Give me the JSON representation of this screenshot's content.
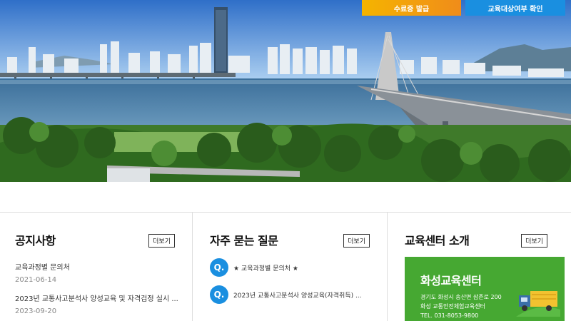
{
  "header": {
    "certificate_button": "수료증 발급",
    "eligibility_button": "교육대상여부 확인"
  },
  "notice": {
    "title": "공지사항",
    "more_label": "더보기",
    "items": [
      {
        "title": "교육과정별 문의처",
        "date": "2021-06-14"
      },
      {
        "title": "2023년 교통사고분석사 양성교육 및 자격검정 실시 ...",
        "date": "2023-09-20"
      }
    ]
  },
  "faq": {
    "title": "자주 묻는 질문",
    "more_label": "더보기",
    "q_marker": "Q.",
    "items": [
      {
        "text": "★ 교육과정별 문의처 ★"
      },
      {
        "text": "2023년 교통사고분석사 양성교육(자격취득) ..."
      }
    ]
  },
  "center": {
    "title": "교육센터 소개",
    "more_label": "더보기",
    "card": {
      "name": "화성교육센터",
      "address": "경기도 화성시 송산면 삼존로 200",
      "facility": "화성 교통안전체험교육센터",
      "tel": "TEL. 031-8053-9800"
    }
  },
  "colors": {
    "accent_blue": "#1a8fe0",
    "accent_orange": "#f5b400",
    "card_green": "#46a832"
  }
}
